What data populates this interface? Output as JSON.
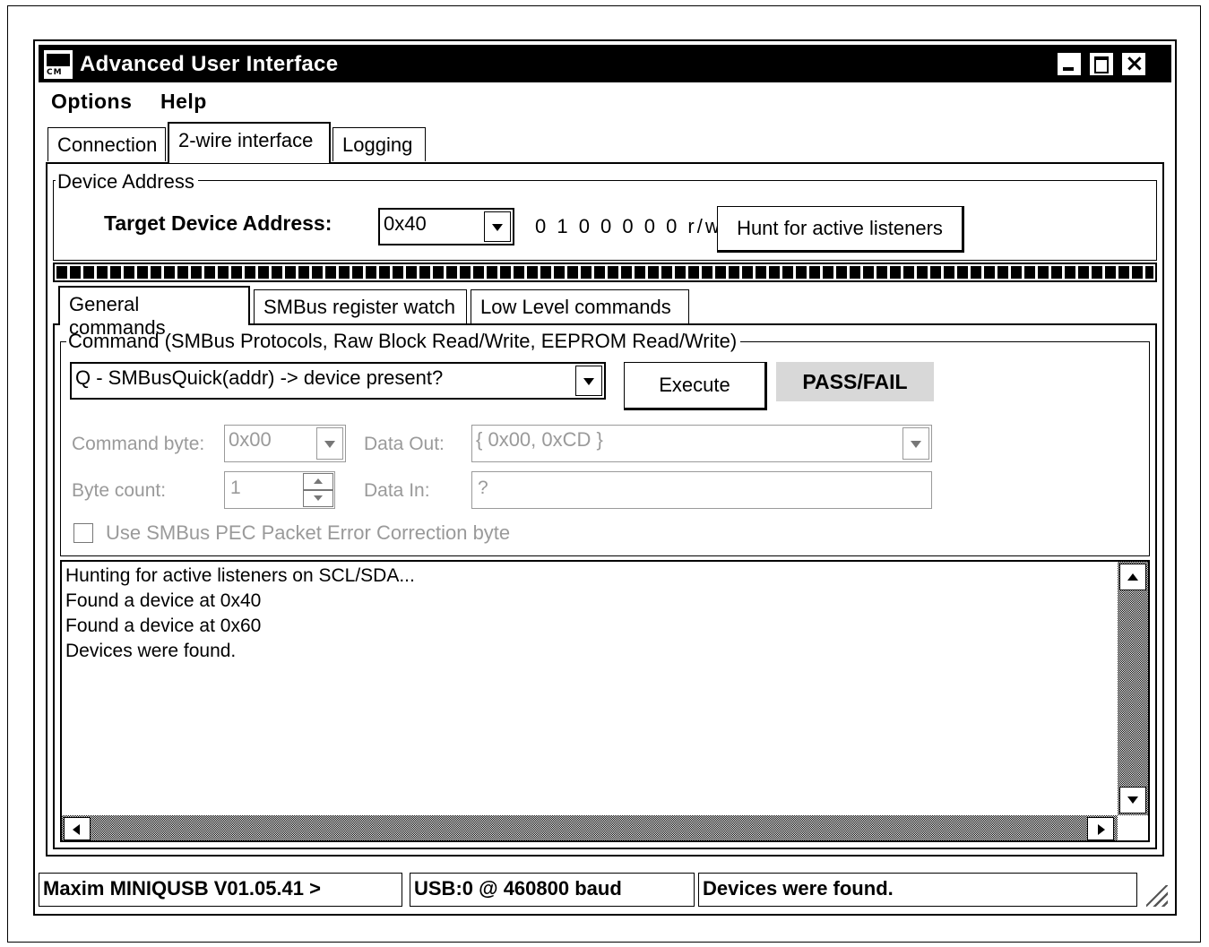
{
  "window": {
    "title": "Advanced User Interface",
    "app_icon_text": "CM"
  },
  "menu": {
    "options": "Options",
    "help": "Help"
  },
  "tabs": [
    "Connection",
    "2-wire interface",
    "Logging"
  ],
  "device_address": {
    "group_label": "Device Address",
    "target_label": "Target Device Address:",
    "address_value": "0x40",
    "bits_text": "0 1 0 0 0 0 0 r/w",
    "hunt_button": "Hunt for active listeners"
  },
  "subtabs": [
    "General commands",
    "SMBus register watch",
    "Low Level commands"
  ],
  "command": {
    "group_label": "Command (SMBus Protocols, Raw Block Read/Write, EEPROM Read/Write)",
    "selected": "Q - SMBusQuick(addr) -> device present?",
    "execute_button": "Execute",
    "result": "PASS/FAIL",
    "command_byte_label": "Command byte:",
    "command_byte_value": "0x00",
    "data_out_label": "Data Out:",
    "data_out_value": "{ 0x00, 0xCD }",
    "byte_count_label": "Byte count:",
    "byte_count_value": "1",
    "data_in_label": "Data In:",
    "data_in_value": "?",
    "pec_label": "Use SMBus PEC Packet Error Correction byte",
    "pec_checked": false
  },
  "log_lines": [
    "Hunting for active listeners on SCL/SDA...",
    "Found a device at 0x40",
    "Found a device at 0x60",
    "Devices were found."
  ],
  "status": {
    "device": "Maxim MINIQUSB V01.05.41 >",
    "port": "USB:0 @ 460800 baud",
    "message": "Devices were found."
  }
}
